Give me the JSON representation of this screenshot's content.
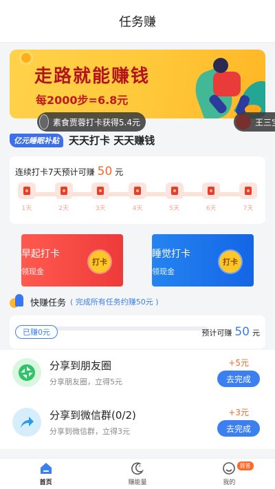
{
  "nav": {
    "title": "任务赚"
  },
  "banner": {
    "title": "走路就能赚钱",
    "subtitle": "每2000步=6.8元"
  },
  "ticker": [
    {
      "text": "素食贾蓉打卡获得5.4元"
    },
    {
      "text": "王三宝"
    }
  ],
  "slogan": {
    "tag": "亿元睡眠补贴",
    "text": "天天打卡  天天赚钱"
  },
  "checkin": {
    "prefix": "连续打卡7天预计可赚",
    "amount": "50",
    "unit": "元",
    "days": [
      "1天",
      "2天",
      "3天",
      "4天",
      "5天",
      "6天",
      "7天"
    ]
  },
  "task_cards": [
    {
      "title": "早起打卡",
      "subtitle": "领现金",
      "button": "打卡"
    },
    {
      "title": "睡觉打卡",
      "subtitle": "领现金",
      "button": "打卡"
    }
  ],
  "quick": {
    "title": "快赚任务",
    "note": "( 完成所有任务约赚50元 )"
  },
  "progress": {
    "earned": "已赚0元",
    "est_prefix": "预计可赚",
    "est_value": "50",
    "est_unit": "元",
    "fraction": 0
  },
  "tasks": [
    {
      "title": "分享到朋友圈",
      "subtitle": "分享朋友圈，立得5元",
      "reward": "+5元",
      "button": "去完成",
      "icon": "wechat-moments-icon"
    },
    {
      "title": "分享到微信群(0/2)",
      "subtitle": "分享到微信群，立得3元",
      "reward": "+3元",
      "button": "去完成",
      "icon": "share-arrow-icon"
    }
  ],
  "tabbar": [
    {
      "label": "首页",
      "icon": "home-icon",
      "active": true
    },
    {
      "label": "赚能量",
      "icon": "moon-icon",
      "active": false
    },
    {
      "label": "我的",
      "icon": "profile-icon",
      "active": false,
      "badge": "目答"
    }
  ],
  "colors": {
    "accent": "#3b7ff0",
    "orange": "#f26a2e",
    "red": "#ee3a3a",
    "yellow": "#ffc83a"
  }
}
